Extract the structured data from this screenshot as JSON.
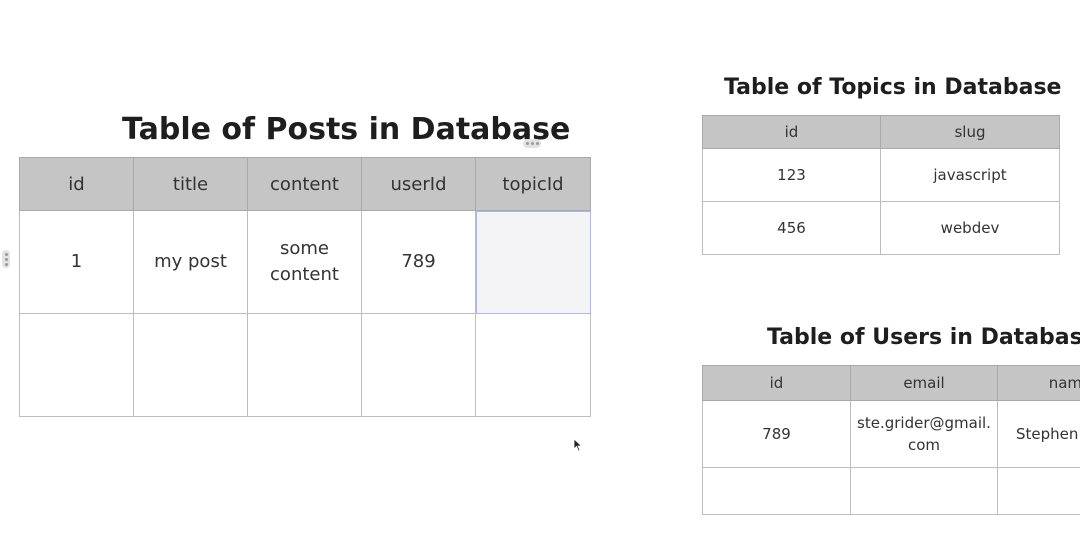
{
  "posts": {
    "title": "Table of Posts in Database",
    "headers": [
      "id",
      "title",
      "content",
      "userId",
      "topicId"
    ],
    "rows": [
      [
        "1",
        "my post",
        "some content",
        "789",
        ""
      ],
      [
        "",
        "",
        "",
        "",
        ""
      ]
    ]
  },
  "topics": {
    "title": "Table of Topics in Database",
    "headers": [
      "id",
      "slug"
    ],
    "rows": [
      [
        "123",
        "javascript"
      ],
      [
        "456",
        "webdev"
      ]
    ]
  },
  "users": {
    "title": "Table of Users in Database",
    "headers": [
      "id",
      "email",
      "name"
    ],
    "rows": [
      [
        "789",
        "ste.grider@gmail.com",
        "Stephen"
      ],
      [
        "",
        "",
        ""
      ]
    ]
  }
}
